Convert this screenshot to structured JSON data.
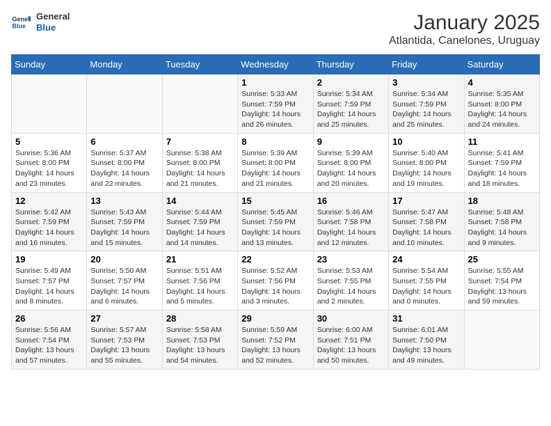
{
  "logo": {
    "general": "General",
    "blue": "Blue"
  },
  "title": "January 2025",
  "subtitle": "Atlantida, Canelones, Uruguay",
  "weekdays": [
    "Sunday",
    "Monday",
    "Tuesday",
    "Wednesday",
    "Thursday",
    "Friday",
    "Saturday"
  ],
  "weeks": [
    [
      {
        "day": "",
        "info": ""
      },
      {
        "day": "",
        "info": ""
      },
      {
        "day": "",
        "info": ""
      },
      {
        "day": "1",
        "info": "Sunrise: 5:33 AM\nSunset: 7:59 PM\nDaylight: 14 hours and 26 minutes."
      },
      {
        "day": "2",
        "info": "Sunrise: 5:34 AM\nSunset: 7:59 PM\nDaylight: 14 hours and 25 minutes."
      },
      {
        "day": "3",
        "info": "Sunrise: 5:34 AM\nSunset: 7:59 PM\nDaylight: 14 hours and 25 minutes."
      },
      {
        "day": "4",
        "info": "Sunrise: 5:35 AM\nSunset: 8:00 PM\nDaylight: 14 hours and 24 minutes."
      }
    ],
    [
      {
        "day": "5",
        "info": "Sunrise: 5:36 AM\nSunset: 8:00 PM\nDaylight: 14 hours and 23 minutes."
      },
      {
        "day": "6",
        "info": "Sunrise: 5:37 AM\nSunset: 8:00 PM\nDaylight: 14 hours and 22 minutes."
      },
      {
        "day": "7",
        "info": "Sunrise: 5:38 AM\nSunset: 8:00 PM\nDaylight: 14 hours and 21 minutes."
      },
      {
        "day": "8",
        "info": "Sunrise: 5:39 AM\nSunset: 8:00 PM\nDaylight: 14 hours and 21 minutes."
      },
      {
        "day": "9",
        "info": "Sunrise: 5:39 AM\nSunset: 8:00 PM\nDaylight: 14 hours and 20 minutes."
      },
      {
        "day": "10",
        "info": "Sunrise: 5:40 AM\nSunset: 8:00 PM\nDaylight: 14 hours and 19 minutes."
      },
      {
        "day": "11",
        "info": "Sunrise: 5:41 AM\nSunset: 7:59 PM\nDaylight: 14 hours and 18 minutes."
      }
    ],
    [
      {
        "day": "12",
        "info": "Sunrise: 5:42 AM\nSunset: 7:59 PM\nDaylight: 14 hours and 16 minutes."
      },
      {
        "day": "13",
        "info": "Sunrise: 5:43 AM\nSunset: 7:59 PM\nDaylight: 14 hours and 15 minutes."
      },
      {
        "day": "14",
        "info": "Sunrise: 5:44 AM\nSunset: 7:59 PM\nDaylight: 14 hours and 14 minutes."
      },
      {
        "day": "15",
        "info": "Sunrise: 5:45 AM\nSunset: 7:59 PM\nDaylight: 14 hours and 13 minutes."
      },
      {
        "day": "16",
        "info": "Sunrise: 5:46 AM\nSunset: 7:58 PM\nDaylight: 14 hours and 12 minutes."
      },
      {
        "day": "17",
        "info": "Sunrise: 5:47 AM\nSunset: 7:58 PM\nDaylight: 14 hours and 10 minutes."
      },
      {
        "day": "18",
        "info": "Sunrise: 5:48 AM\nSunset: 7:58 PM\nDaylight: 14 hours and 9 minutes."
      }
    ],
    [
      {
        "day": "19",
        "info": "Sunrise: 5:49 AM\nSunset: 7:57 PM\nDaylight: 14 hours and 8 minutes."
      },
      {
        "day": "20",
        "info": "Sunrise: 5:50 AM\nSunset: 7:57 PM\nDaylight: 14 hours and 6 minutes."
      },
      {
        "day": "21",
        "info": "Sunrise: 5:51 AM\nSunset: 7:56 PM\nDaylight: 14 hours and 5 minutes."
      },
      {
        "day": "22",
        "info": "Sunrise: 5:52 AM\nSunset: 7:56 PM\nDaylight: 14 hours and 3 minutes."
      },
      {
        "day": "23",
        "info": "Sunrise: 5:53 AM\nSunset: 7:55 PM\nDaylight: 14 hours and 2 minutes."
      },
      {
        "day": "24",
        "info": "Sunrise: 5:54 AM\nSunset: 7:55 PM\nDaylight: 14 hours and 0 minutes."
      },
      {
        "day": "25",
        "info": "Sunrise: 5:55 AM\nSunset: 7:54 PM\nDaylight: 13 hours and 59 minutes."
      }
    ],
    [
      {
        "day": "26",
        "info": "Sunrise: 5:56 AM\nSunset: 7:54 PM\nDaylight: 13 hours and 57 minutes."
      },
      {
        "day": "27",
        "info": "Sunrise: 5:57 AM\nSunset: 7:53 PM\nDaylight: 13 hours and 55 minutes."
      },
      {
        "day": "28",
        "info": "Sunrise: 5:58 AM\nSunset: 7:53 PM\nDaylight: 13 hours and 54 minutes."
      },
      {
        "day": "29",
        "info": "Sunrise: 5:59 AM\nSunset: 7:52 PM\nDaylight: 13 hours and 52 minutes."
      },
      {
        "day": "30",
        "info": "Sunrise: 6:00 AM\nSunset: 7:51 PM\nDaylight: 13 hours and 50 minutes."
      },
      {
        "day": "31",
        "info": "Sunrise: 6:01 AM\nSunset: 7:50 PM\nDaylight: 13 hours and 49 minutes."
      },
      {
        "day": "",
        "info": ""
      }
    ]
  ]
}
